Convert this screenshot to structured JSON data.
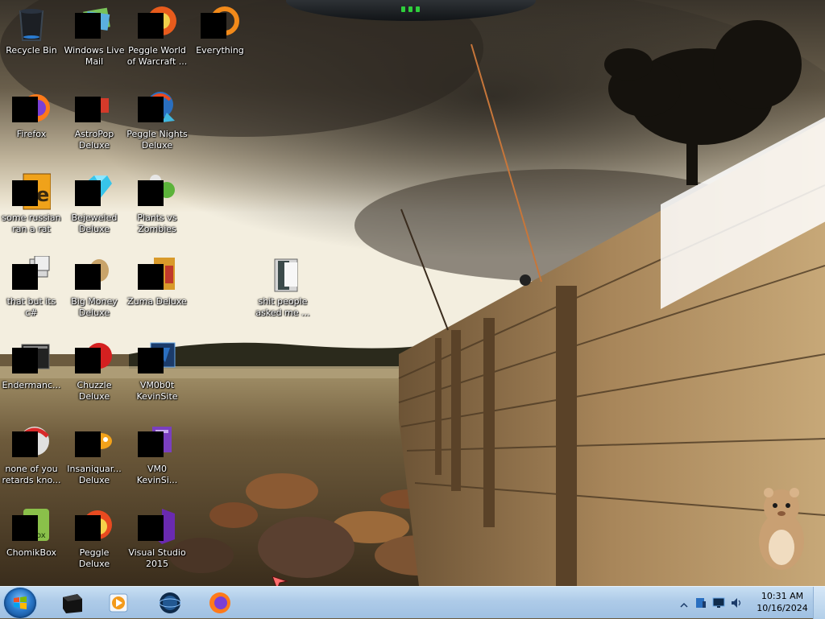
{
  "desktop": {
    "icons": [
      {
        "label": "Recycle Bin",
        "icon": "recycle-bin-icon"
      },
      {
        "label": "Windows Live Mail",
        "icon": "mail-icon"
      },
      {
        "label": "Peggle World of Warcraft ...",
        "icon": "peggle-icon"
      },
      {
        "label": "Everything",
        "icon": "search-icon"
      },
      {
        "label": "Firefox",
        "icon": "firefox-icon"
      },
      {
        "label": "AstroPop Deluxe",
        "icon": "astropop-icon"
      },
      {
        "label": "Peggle Nights Deluxe",
        "icon": "peggle-nights-icon"
      },
      {
        "label": "some russian ran a rat",
        "icon": "media-file-icon"
      },
      {
        "label": "Bejeweled Deluxe",
        "icon": "gem-icon"
      },
      {
        "label": "Plants vs Zombies",
        "icon": "plant-icon"
      },
      {
        "label": "that but its c#",
        "icon": "shortcut-icon"
      },
      {
        "label": "Big Money Deluxe",
        "icon": "money-bag-icon"
      },
      {
        "label": "Zuma Deluxe",
        "icon": "zuma-icon"
      },
      {
        "label": "shit people asked me ...",
        "icon": "folder-icon"
      },
      {
        "label": "Endermanc...",
        "icon": "window-icon"
      },
      {
        "label": "Chuzzle Deluxe",
        "icon": "chuzzle-icon"
      },
      {
        "label": "VM0b0t KevinSite",
        "icon": "vm-icon"
      },
      {
        "label": "none of you retards kno...",
        "icon": "game-icon"
      },
      {
        "label": "Insaniquar... Deluxe",
        "icon": "fish-icon"
      },
      {
        "label": "VM0 KevinSi...",
        "icon": "vm-document-icon"
      },
      {
        "label": "ChomikBox",
        "icon": "chomikbox-icon"
      },
      {
        "label": "Peggle Deluxe",
        "icon": "peggle-deluxe-icon"
      },
      {
        "label": "Visual Studio 2015",
        "icon": "visual-studio-icon"
      }
    ]
  },
  "taskbar": {
    "start": "start-orb-icon",
    "pinned": [
      {
        "name": "black-box-app-icon"
      },
      {
        "name": "media-player-icon"
      },
      {
        "name": "globe-app-icon"
      },
      {
        "name": "firefox-icon"
      }
    ],
    "clock": {
      "time": "10:31 AM",
      "date": "10/16/2024"
    }
  },
  "colors": {
    "taskbar": "#aecbe8",
    "accent_green": "#2fcf3c"
  }
}
